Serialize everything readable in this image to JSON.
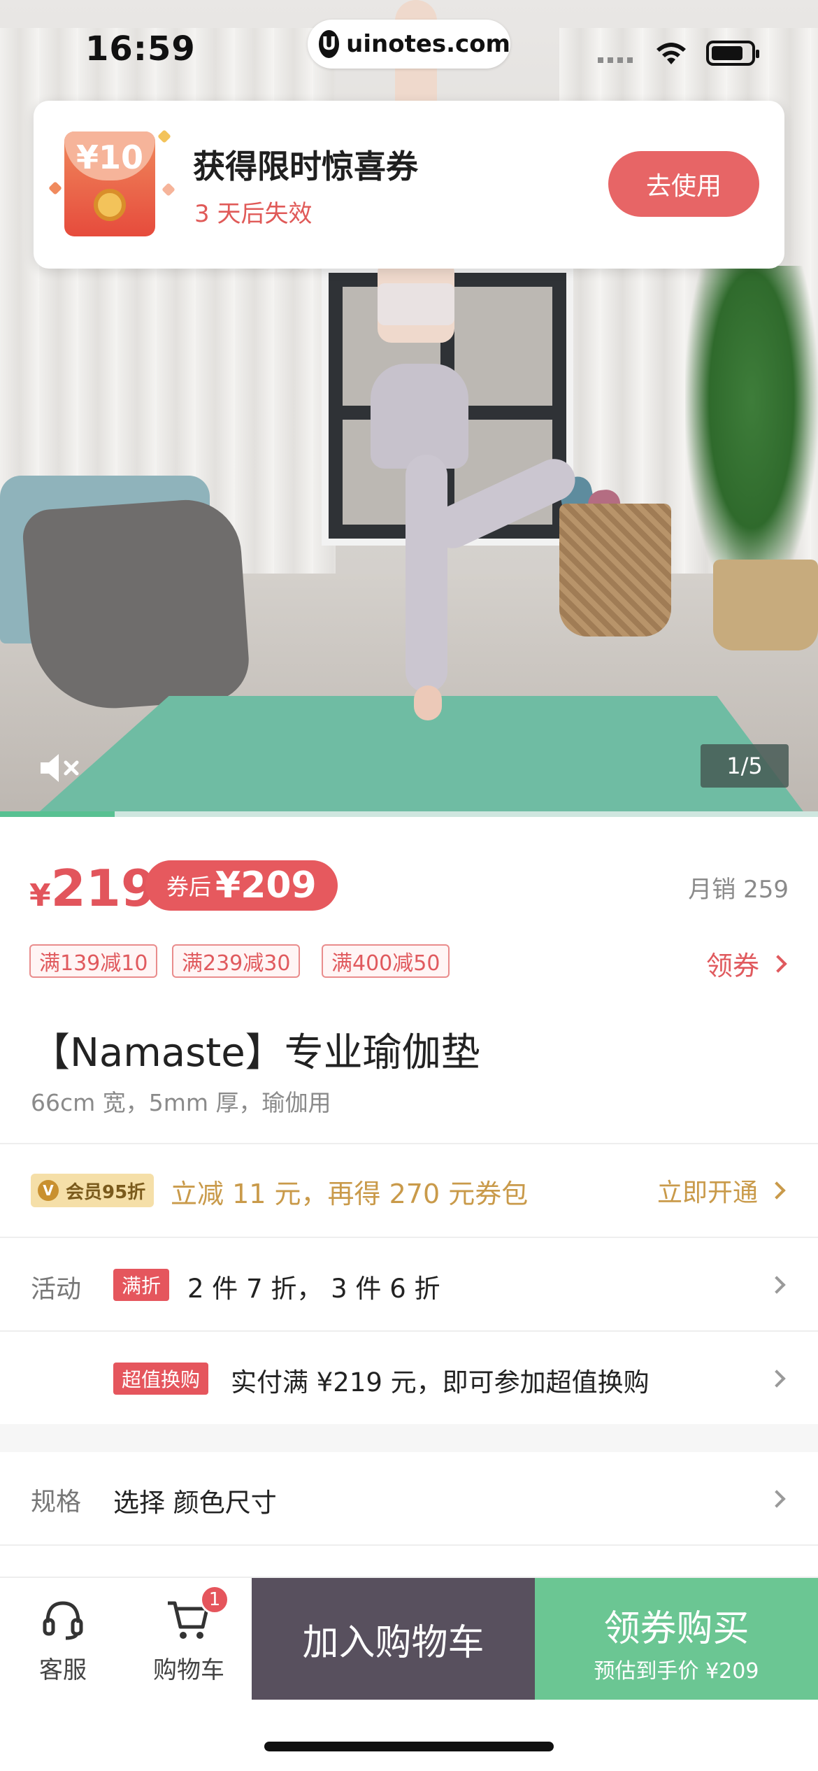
{
  "status": {
    "time": "16:59",
    "url": "uinotes.com"
  },
  "coupon_popup": {
    "amount": "¥10",
    "title": "获得限时惊喜券",
    "subtitle": "3 天后失效",
    "button": "去使用"
  },
  "media": {
    "page_indicator": "1/5",
    "video_progress": 0.14
  },
  "price": {
    "currency": "¥",
    "value": "219",
    "after_coupon_label": "券后",
    "after_coupon_value": "¥209",
    "monthly_sales": "月销 259"
  },
  "coupon_tags": [
    "满139减10",
    "满239减30",
    "满400减50"
  ],
  "get_coupon": "领券",
  "product": {
    "title": "【Namaste】专业瑜伽垫",
    "subtitle": "66cm 宽，5mm 厚，瑜伽用"
  },
  "member": {
    "badge": "会员95折",
    "badge_icon": "V",
    "text": "立减 11 元，再得 270 元券包",
    "action": "立即开通"
  },
  "activity": {
    "label": "活动",
    "tag": "满折",
    "text": "2 件 7 折， 3 件 6 折"
  },
  "exchange": {
    "tag": "超值换购",
    "text": "实付满 ¥219 元，即可参加超值换购"
  },
  "spec": {
    "label": "规格",
    "text": "选择 颜色尺寸"
  },
  "bottom_bar": {
    "service": "客服",
    "cart": "购物车",
    "cart_badge": "1",
    "add_to_cart": "加入购物车",
    "buy_title": "领券购买",
    "buy_sub": "预估到手价 ¥209"
  },
  "colors": {
    "accent_red": "#e6595e",
    "cart_btn": "#58505e",
    "buy_btn": "#6bc693",
    "member_gold": "#c99a4a"
  }
}
